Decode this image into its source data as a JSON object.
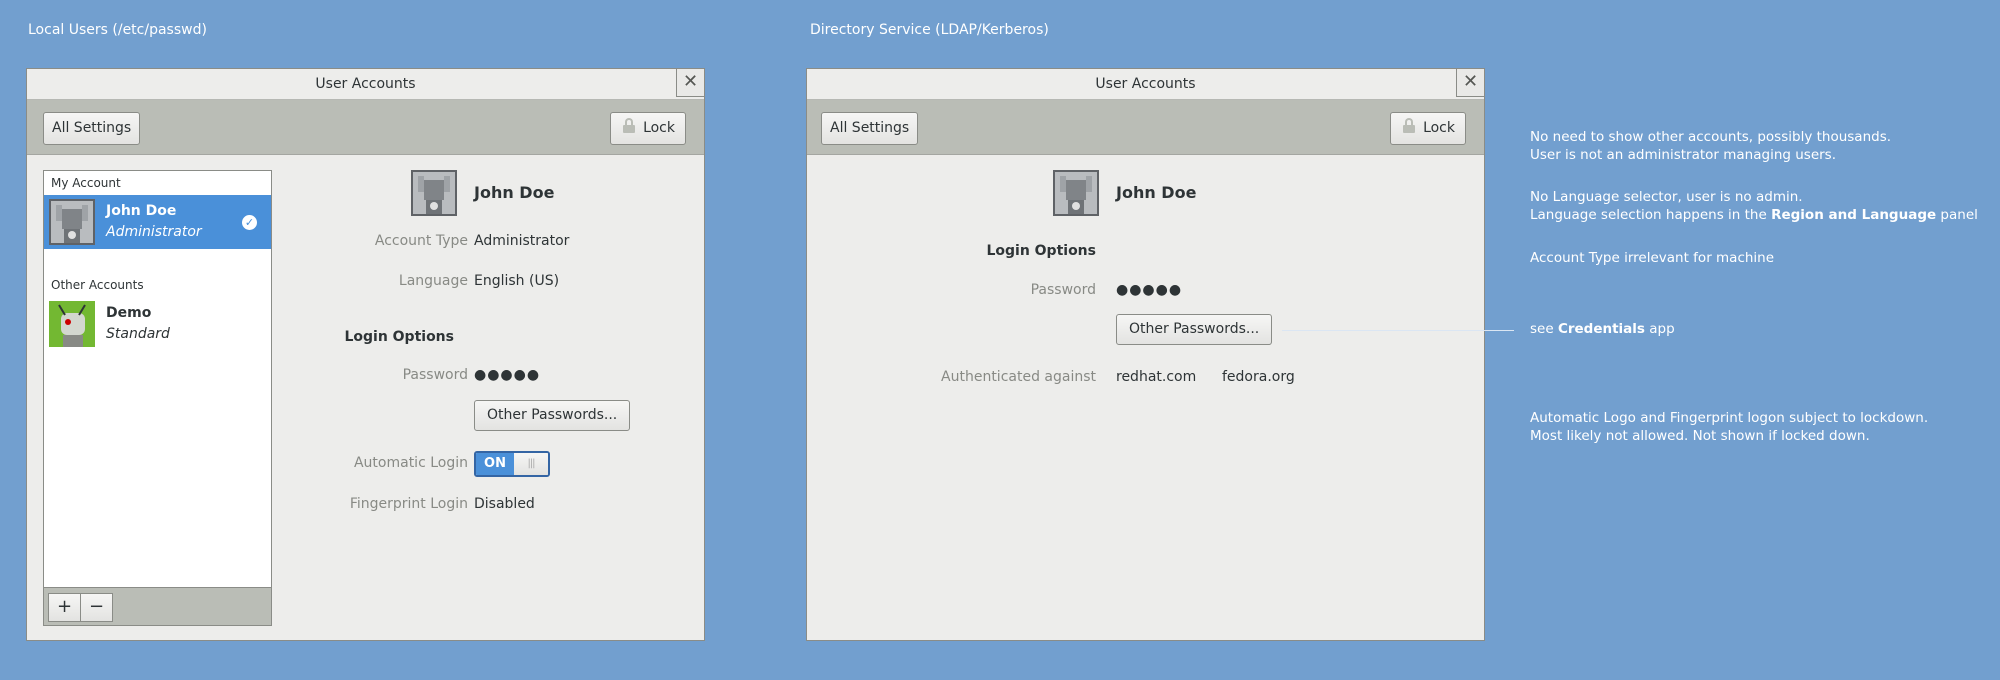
{
  "left": {
    "section_title": "Local Users (/etc/passwd)",
    "window_title": "User Accounts",
    "all_settings": "All Settings",
    "lock": "Lock",
    "list": {
      "my_account_label": "My Account",
      "other_accounts_label": "Other Accounts",
      "users": [
        {
          "name": "John Doe",
          "role": "Administrator",
          "selected": true
        },
        {
          "name": "Demo",
          "role": "Standard",
          "selected": false
        }
      ],
      "add": "+",
      "remove": "−"
    },
    "detail": {
      "name": "John Doe",
      "account_type_label": "Account Type",
      "account_type_value": "Administrator",
      "language_label": "Language",
      "language_value": "English (US)",
      "login_options": "Login Options",
      "password_label": "Password",
      "password_value": "●●●●●",
      "other_passwords": "Other Passwords...",
      "auto_login_label": "Automatic Login",
      "auto_login_state": "ON",
      "fingerprint_label": "Fingerprint Login",
      "fingerprint_value": "Disabled"
    }
  },
  "right": {
    "section_title": "Directory Service (LDAP/Kerberos)",
    "window_title": "User Accounts",
    "all_settings": "All Settings",
    "lock": "Lock",
    "detail": {
      "name": "John Doe",
      "login_options": "Login Options",
      "password_label": "Password",
      "password_value": "●●●●●",
      "other_passwords": "Other Passwords...",
      "auth_label": "Authenticated against",
      "auth_values": [
        "redhat.com",
        "fedora.org"
      ]
    }
  },
  "notes": {
    "n1_line1": "No need to show other accounts, possibly thousands.",
    "n1_line2": "User is not an administrator managing users.",
    "n2_line1": "No Language selector, user is no admin.",
    "n2_line2_pre": "Language selection happens in the ",
    "n2_line2_bold": "Region and Language",
    "n2_line2_post": " panel",
    "n3": "Account Type irrelevant for machine",
    "n4_pre": "see ",
    "n4_bold": "Credentials",
    "n4_post": " app",
    "n5_line1": "Automatic Logo and Fingerprint logon subject to lockdown.",
    "n5_line2": "Most likely not allowed. Not shown if locked down."
  },
  "colors": {
    "background": "#729fcf",
    "selection": "#4a90d9",
    "toolbar": "#babdb6"
  }
}
